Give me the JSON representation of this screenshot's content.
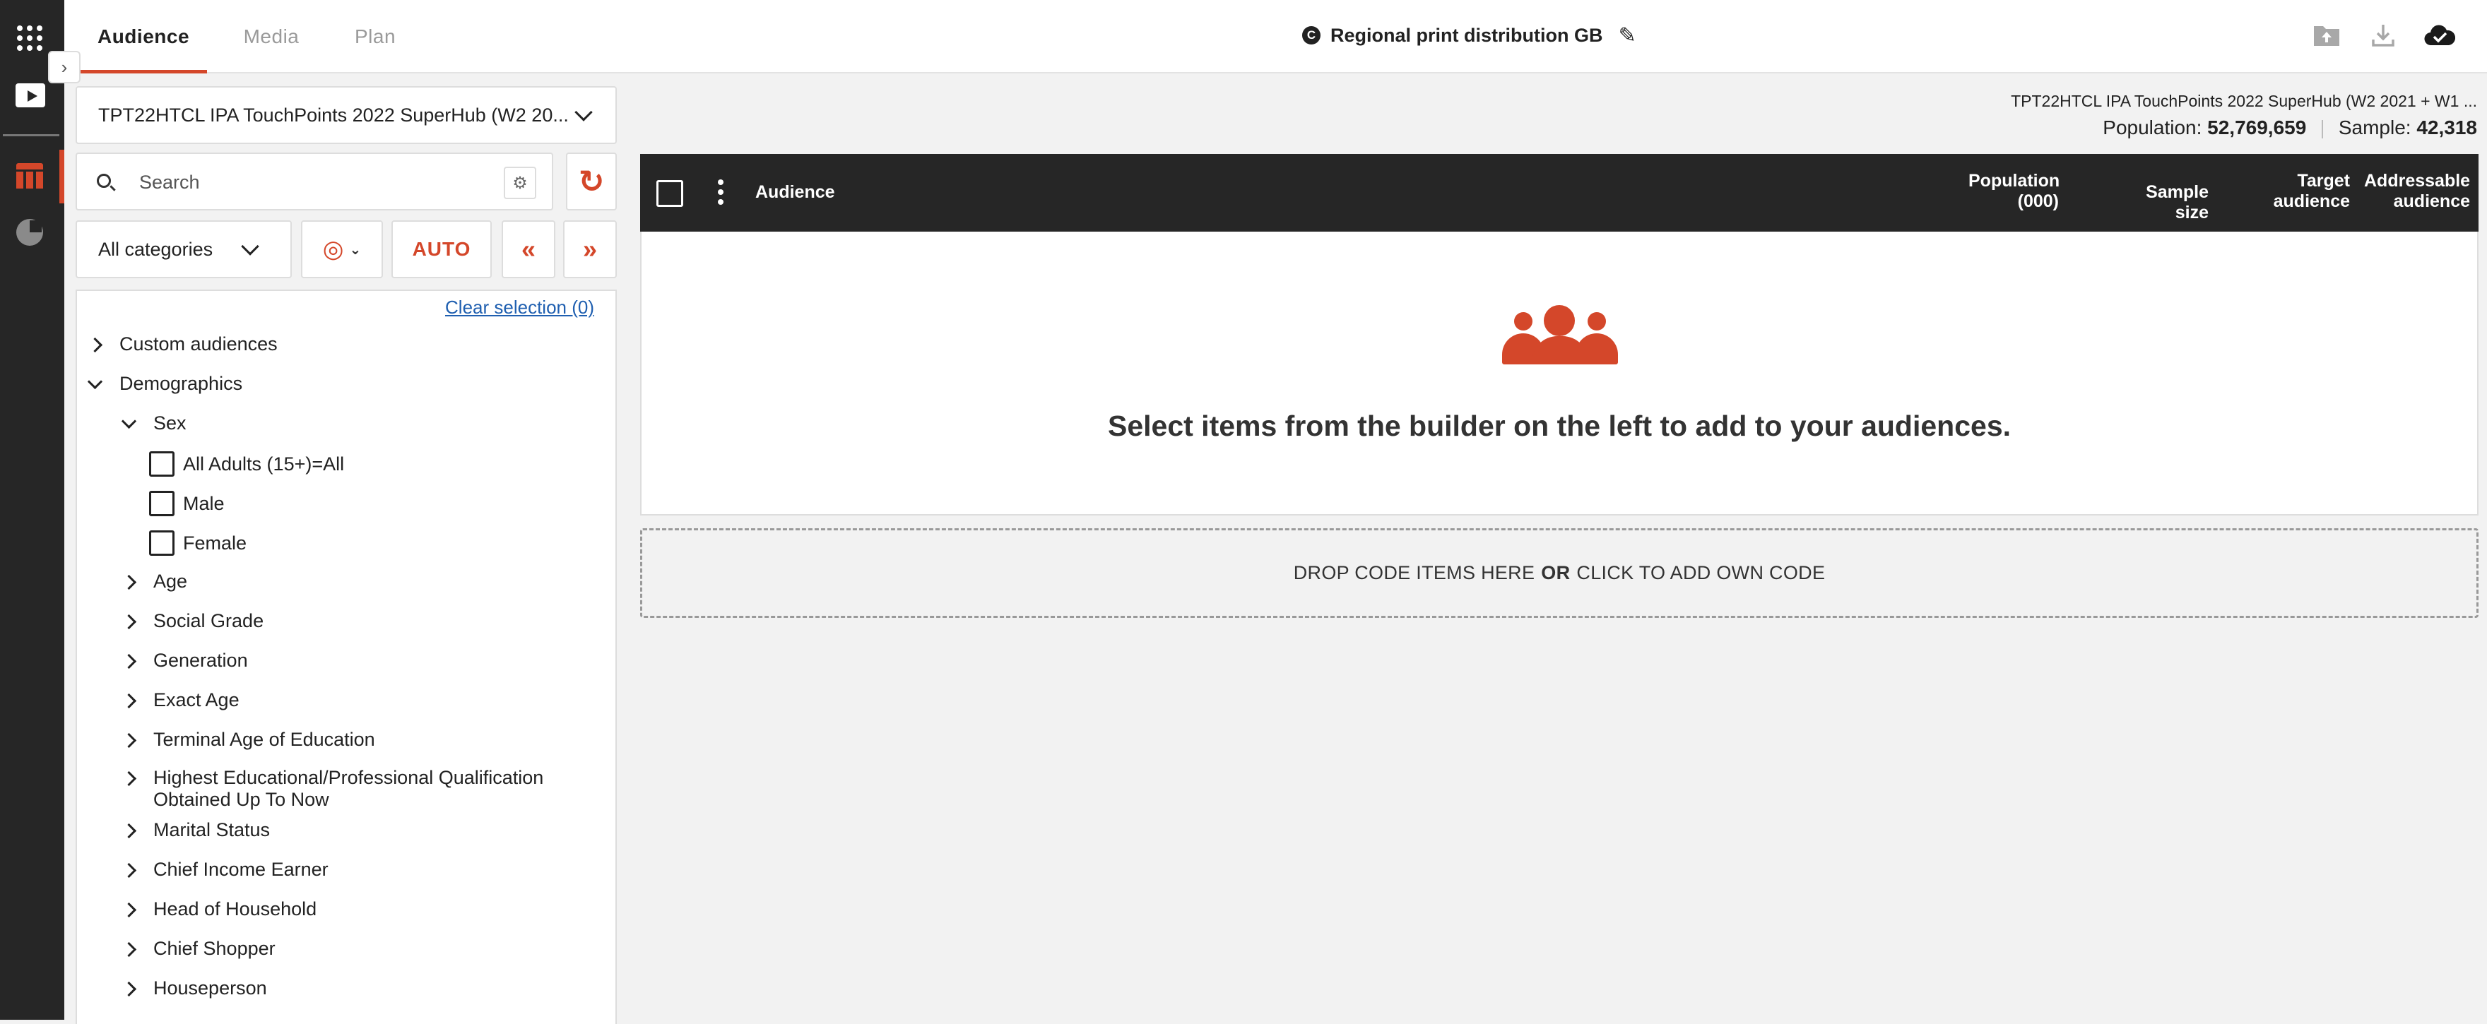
{
  "nav": {
    "tabs": [
      {
        "label": "Audience",
        "active": true
      },
      {
        "label": "Media",
        "active": false
      },
      {
        "label": "Plan",
        "active": false
      }
    ],
    "document_badge": "C",
    "document_title": "Regional print distribution GB",
    "expand_glyph": "›",
    "actions": [
      {
        "icon": "upload-folder-icon"
      },
      {
        "icon": "download-icon"
      },
      {
        "icon": "cloud-saved-icon"
      }
    ]
  },
  "rail": {
    "items": [
      {
        "icon": "apps-grid-icon"
      },
      {
        "icon": "play-video-icon"
      },
      {
        "icon": "table-icon",
        "active": true
      },
      {
        "icon": "pie-chart-icon"
      }
    ]
  },
  "builder": {
    "dataset_label": "TPT22HTCL IPA TouchPoints 2022 SuperHub (W2 20...",
    "search_placeholder": "Search",
    "filter_glyph": "⚙",
    "category_select": "All categories",
    "venn_glyph": "◎",
    "auto_label": "AUTO",
    "collapse_glyph": "«",
    "expand_glyph": "»",
    "refresh_glyph": "↻",
    "clear_selection": "Clear selection (0)",
    "tree": [
      {
        "label": "Custom audiences",
        "level": 0,
        "state": "collapsed"
      },
      {
        "label": "Demographics",
        "level": 0,
        "state": "expanded"
      },
      {
        "label": "Sex",
        "level": 1,
        "state": "expanded"
      },
      {
        "label": "All Adults (15+)=All",
        "level": 2,
        "state": "checkbox",
        "checked": false
      },
      {
        "label": "Male",
        "level": 2,
        "state": "checkbox",
        "checked": false
      },
      {
        "label": "Female",
        "level": 2,
        "state": "checkbox",
        "checked": false
      },
      {
        "label": "Age",
        "level": 1,
        "state": "collapsed"
      },
      {
        "label": "Social Grade",
        "level": 1,
        "state": "collapsed"
      },
      {
        "label": "Generation",
        "level": 1,
        "state": "collapsed"
      },
      {
        "label": "Exact Age",
        "level": 1,
        "state": "collapsed"
      },
      {
        "label": "Terminal Age of Education",
        "level": 1,
        "state": "collapsed"
      },
      {
        "label": "Highest Educational/Professional Qualification Obtained Up To Now",
        "level": 1,
        "state": "collapsed"
      },
      {
        "label": "Marital Status",
        "level": 1,
        "state": "collapsed"
      },
      {
        "label": "Chief Income Earner",
        "level": 1,
        "state": "collapsed"
      },
      {
        "label": "Head of Household",
        "level": 1,
        "state": "collapsed"
      },
      {
        "label": "Chief Shopper",
        "level": 1,
        "state": "collapsed"
      },
      {
        "label": "Houseperson",
        "level": 1,
        "state": "collapsed"
      }
    ]
  },
  "summary": {
    "dataset_full": "TPT22HTCL IPA TouchPoints 2022 SuperHub (W2 2021 + W1 ...",
    "population_label": "Population:",
    "population_value": "52,769,659",
    "sample_label": "Sample:",
    "sample_value": "42,318"
  },
  "grid": {
    "columns": [
      "Audience",
      "Population (000)",
      "Sample size",
      "Target audience",
      "Addressable audience"
    ],
    "empty_message": "Select items from the builder on the left to add to your audiences.",
    "empty_icon": "people-group-icon",
    "drop_pre": "DROP CODE ITEMS HERE",
    "drop_or": "OR",
    "drop_post": "CLICK TO ADD OWN CODE"
  },
  "colors": {
    "accent": "#d4472a",
    "rail_bg": "#262626",
    "header_bg": "#262626",
    "link": "#1f5fb0"
  }
}
